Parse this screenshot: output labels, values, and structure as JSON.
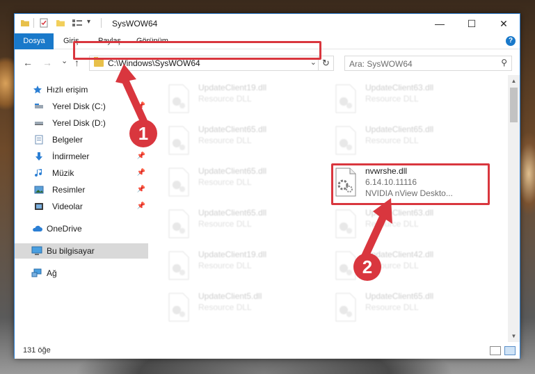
{
  "window": {
    "title": "SysWOW64",
    "controls": {
      "minimize": "—",
      "maximize": "☐",
      "close": "✕"
    }
  },
  "ribbon": {
    "tabs": [
      "Dosya",
      "Giriş",
      "Paylaş",
      "Görünüm"
    ],
    "help": "?"
  },
  "nav": {
    "back": "←",
    "forward": "→",
    "recent": "⌄",
    "up": "↑",
    "address": "C:\\Windows\\SysWOW64",
    "address_dropdown": "⌄",
    "refresh": "↻",
    "search_placeholder": "Ara: SysWOW64",
    "search_icon": "⚲"
  },
  "sidebar": {
    "items": [
      {
        "label": "Hızlı erişim",
        "icon": "star-icon",
        "pinned": false
      },
      {
        "label": "Yerel Disk (C:)",
        "icon": "drive-icon",
        "pinned": true
      },
      {
        "label": "Yerel Disk (D:)",
        "icon": "drive-icon",
        "pinned": true
      },
      {
        "label": "Belgeler",
        "icon": "document-icon",
        "pinned": true
      },
      {
        "label": "İndirmeler",
        "icon": "download-icon",
        "pinned": true
      },
      {
        "label": "Müzik",
        "icon": "music-icon",
        "pinned": true
      },
      {
        "label": "Resimler",
        "icon": "pictures-icon",
        "pinned": true
      },
      {
        "label": "Videolar",
        "icon": "video-icon",
        "pinned": true
      },
      {
        "label": "OneDrive",
        "icon": "cloud-icon",
        "pinned": false
      },
      {
        "label": "Bu bilgisayar",
        "icon": "computer-icon",
        "pinned": false,
        "selected": true
      },
      {
        "label": "Ağ",
        "icon": "network-icon",
        "pinned": false
      }
    ],
    "pin_glyph": "📌"
  },
  "files": [
    {
      "name": "UpdateClient19.dll",
      "type": "Resource DLL"
    },
    {
      "name": "UpdateClient63.dll",
      "type": "Resource DLL"
    },
    {
      "name": "UpdateClient65.dll",
      "type": "Resource DLL"
    },
    {
      "name": "UpdateClient65.dll",
      "type": "Resource DLL"
    },
    {
      "name": "UpdateClient65.dll",
      "type": "Resource DLL"
    },
    {
      "name": "nvwrshe.dll",
      "version": "6.14.10.11116",
      "description": "NVIDIA nView Deskto...",
      "highlighted": true
    },
    {
      "name": "UpdateClient65.dll",
      "type": "Resource DLL"
    },
    {
      "name": "UpdateClient63.dll",
      "type": "Resource DLL"
    },
    {
      "name": "UpdateClient19.dll",
      "type": "Resource DLL"
    },
    {
      "name": "UpdateClient42.dll",
      "type": "Resource DLL"
    },
    {
      "name": "UpdateClient5.dll",
      "type": "Resource DLL"
    },
    {
      "name": "UpdateClient65.dll",
      "type": "Resource DLL"
    }
  ],
  "status": {
    "count": "131 öğe"
  },
  "annotations": {
    "step1": "1",
    "step2": "2",
    "color": "#d9363e"
  }
}
